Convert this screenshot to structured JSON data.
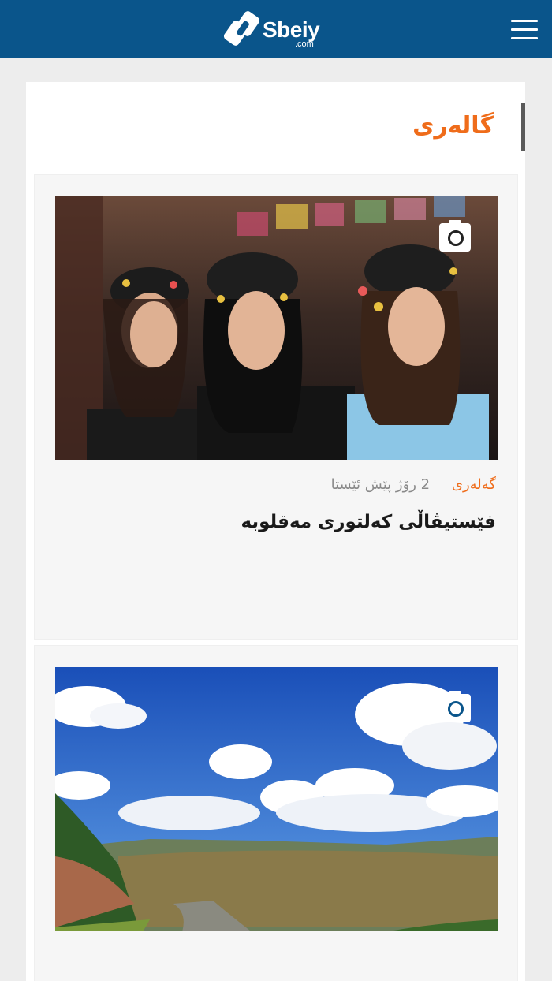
{
  "header": {
    "logo_text": "Sbeiy",
    "logo_domain": ".com",
    "menu_icon": "hamburger-menu-icon",
    "background_color": "#0a558b"
  },
  "section": {
    "title": "گالەری",
    "accent_color": "#ef6c1a"
  },
  "articles": [
    {
      "category": "گەلەری",
      "time_ago": "2 رۆژ پێش ئێستا",
      "title": "فێستیڤاڵی کەلتوری مەقلوبە",
      "badge_icon": "camera-icon"
    },
    {
      "badge_icon": "camera-icon"
    }
  ]
}
